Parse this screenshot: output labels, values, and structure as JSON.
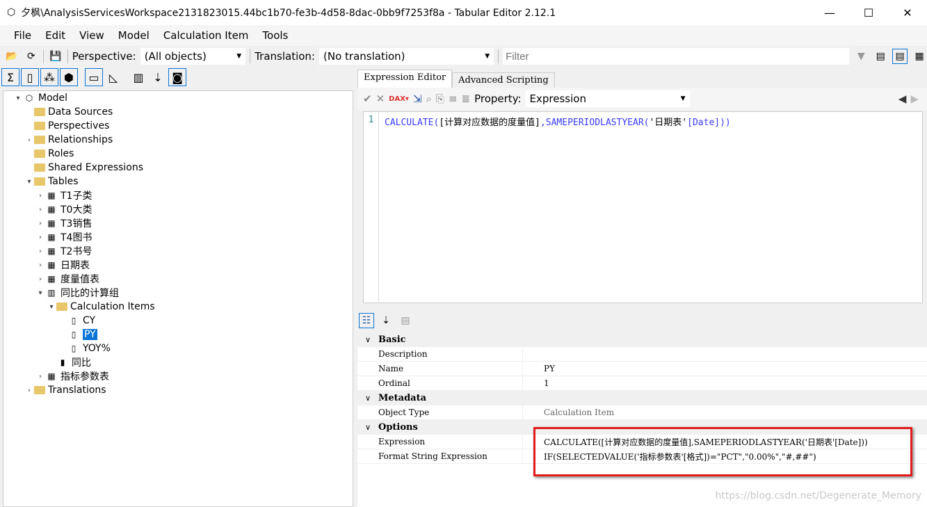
{
  "window": {
    "title": "夕枫\\AnalysisServicesWorkspace2131823015.44bc1b70-fe3b-4d58-8dac-0bb9f7253f8a - Tabular Editor 2.12.1",
    "minimize": "—",
    "maximize": "☐",
    "close": "✕"
  },
  "menu": [
    "File",
    "Edit",
    "View",
    "Model",
    "Calculation Item",
    "Tools"
  ],
  "toolbar": {
    "perspective_label": "Perspective:",
    "perspective_value": "(All objects)",
    "translation_label": "Translation:",
    "translation_value": "(No translation)",
    "filter_placeholder": "Filter"
  },
  "tree": [
    {
      "label": "Model",
      "level": 0,
      "icon": "cube-icon",
      "exp": "v"
    },
    {
      "label": "Data Sources",
      "level": 1,
      "icon": "folder-icon",
      "exp": ""
    },
    {
      "label": "Perspectives",
      "level": 1,
      "icon": "folder-icon",
      "exp": ""
    },
    {
      "label": "Relationships",
      "level": 1,
      "icon": "folder-icon",
      "exp": ">"
    },
    {
      "label": "Roles",
      "level": 1,
      "icon": "folder-icon",
      "exp": ""
    },
    {
      "label": "Shared Expressions",
      "level": 1,
      "icon": "folder-icon",
      "exp": ""
    },
    {
      "label": "Tables",
      "level": 1,
      "icon": "folder-icon",
      "exp": "v"
    },
    {
      "label": "T1子类",
      "level": 2,
      "icon": "table-icon",
      "exp": ">"
    },
    {
      "label": "T0大类",
      "level": 2,
      "icon": "table-icon",
      "exp": ">"
    },
    {
      "label": "T3销售",
      "level": 2,
      "icon": "table-icon",
      "exp": ">"
    },
    {
      "label": "T4图书",
      "level": 2,
      "icon": "table-icon",
      "exp": ">"
    },
    {
      "label": "T2书号",
      "level": 2,
      "icon": "table-icon",
      "exp": ">"
    },
    {
      "label": "日期表",
      "level": 2,
      "icon": "calc-table-icon",
      "exp": ">"
    },
    {
      "label": "度量值表",
      "level": 2,
      "icon": "table-icon",
      "exp": ">"
    },
    {
      "label": "同比的计算组",
      "level": 2,
      "icon": "calc-group-icon",
      "exp": "v"
    },
    {
      "label": "Calculation Items",
      "level": 3,
      "icon": "folder-icon",
      "exp": "v"
    },
    {
      "label": "CY",
      "level": 4,
      "icon": "calculator-icon",
      "exp": ""
    },
    {
      "label": "PY",
      "level": 4,
      "icon": "calculator-icon",
      "exp": "",
      "selected": true
    },
    {
      "label": "YOY%",
      "level": 4,
      "icon": "calculator-icon",
      "exp": ""
    },
    {
      "label": "同比",
      "level": 3,
      "icon": "column-icon",
      "exp": ""
    },
    {
      "label": "指标参数表",
      "level": 2,
      "icon": "calc-table-icon",
      "exp": ">"
    },
    {
      "label": "Translations",
      "level": 1,
      "icon": "folder-icon",
      "exp": ">"
    }
  ],
  "editor": {
    "tabs": [
      "Expression Editor",
      "Advanced Scripting"
    ],
    "property_label": "Property:",
    "property_value": "Expression",
    "line_number": "1",
    "code_fn": "CALCULATE(",
    "code_ref": "[计算对应数据的度量值]",
    "code_fn2": ",SAMEPERIODLASTYEAR(",
    "code_tbl": "'日期表'",
    "code_tail": "[Date]))"
  },
  "properties": {
    "categories": [
      {
        "name": "Basic",
        "rows": [
          [
            "Description",
            ""
          ],
          [
            "Name",
            "PY"
          ],
          [
            "Ordinal",
            "1"
          ]
        ]
      },
      {
        "name": "Metadata",
        "rows": [
          [
            "Object Type",
            "Calculation Item"
          ]
        ]
      },
      {
        "name": "Options",
        "rows": [
          [
            "Expression",
            "CALCULATE([计算对应数据的度量值],SAMEPERIODLASTYEAR('日期表'[Date]))"
          ],
          [
            "Format String Expression",
            "IF(SELECTEDVALUE('指标参数表'[格式])=\"PCT\",\"0.00%\",\"#,##\")"
          ]
        ]
      }
    ]
  },
  "watermark": "https://blog.csdn.net/Degenerate_Memory",
  "colors": {
    "selection": "#0a74d8",
    "highlight_box": "#e21b1b",
    "code_keyword": "#3a3aff"
  }
}
